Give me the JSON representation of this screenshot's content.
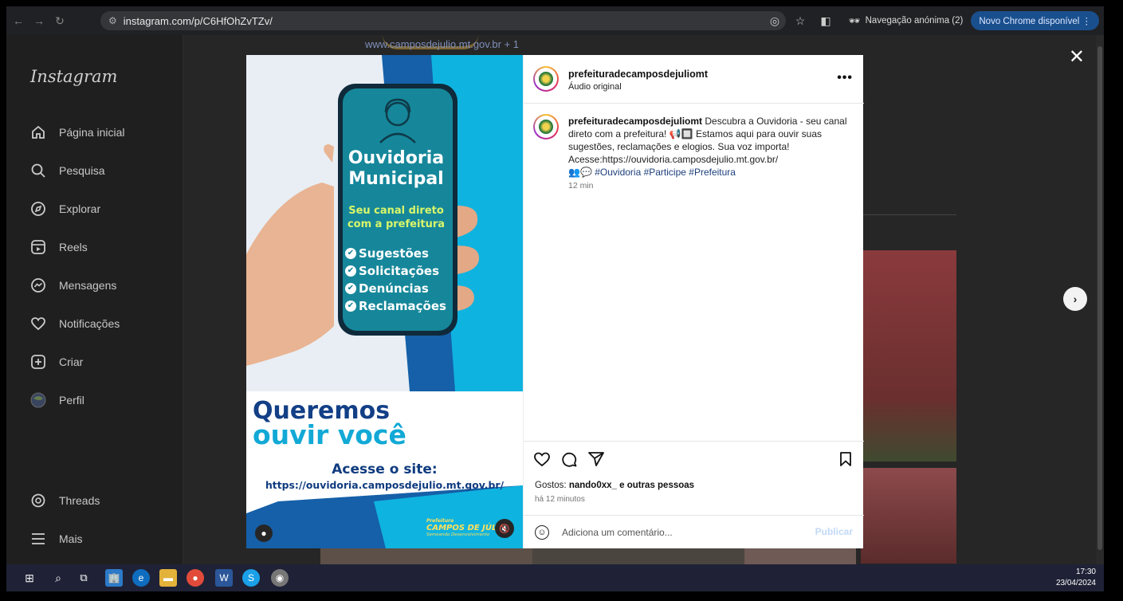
{
  "browser": {
    "url": "instagram.com/p/C6HfOhZvTZv/",
    "incognito_label": "Navegação anónima (2)",
    "update_label": "Novo Chrome disponível"
  },
  "sidebar": {
    "logo": "Instagram",
    "items": [
      {
        "label": "Página inicial",
        "icon": "home-icon"
      },
      {
        "label": "Pesquisa",
        "icon": "search-icon"
      },
      {
        "label": "Explorar",
        "icon": "compass-icon"
      },
      {
        "label": "Reels",
        "icon": "reels-icon"
      },
      {
        "label": "Mensagens",
        "icon": "messenger-icon"
      },
      {
        "label": "Notificações",
        "icon": "heart-icon"
      },
      {
        "label": "Criar",
        "icon": "plus-square-icon"
      },
      {
        "label": "Perfil",
        "icon": "profile-avatar-icon"
      }
    ],
    "bottom_items": [
      {
        "label": "Threads",
        "icon": "threads-icon"
      },
      {
        "label": "Mais",
        "icon": "menu-icon"
      }
    ]
  },
  "background": {
    "link_text": "www.camposdejulio.mt.gov.br + 1"
  },
  "post": {
    "image": {
      "title_line1": "Ouvidoria",
      "title_line2": "Municipal",
      "subtitle_line1": "Seu canal direto",
      "subtitle_line2": "com a prefeitura",
      "list": [
        "Sugestões",
        "Solicitações",
        "Denúncias",
        "Reclamações"
      ],
      "headline_line1": "Queremos",
      "headline_line2": "ouvir você",
      "cta": "Acesse o site:",
      "site": "https://ouvidoria.camposdejulio.mt.gov.br/",
      "logo_small": "Prefeitura",
      "logo_name": "CAMPOS DE JÚLIO",
      "logo_tagline": "Semeando Desenvolvimento"
    },
    "username": "prefeituradecamposdejuliomt",
    "audio": "Áudio original",
    "caption_user": "prefeituradecamposdejuliomt",
    "caption_text": "Descubra a Ouvidoria - seu canal direto com a prefeitura! 📢🔲 Estamos aqui para ouvir suas sugestões, reclamações e elogios. Sua voz importa! Acesse:https://ouvidoria.camposdejulio.mt.gov.br/",
    "caption_tags": "👥💬 #Ouvidoria #Participe #Prefeitura",
    "time": "12 min",
    "likes_prefix": "Gostos: ",
    "likes_user": "nando0xx_",
    "likes_suffix": " e outras pessoas",
    "ago": "há 12 minutos",
    "comment_placeholder": "Adiciona um comentário...",
    "publish_label": "Publicar"
  },
  "taskbar": {
    "time": "17:30",
    "date": "23/04/2024"
  },
  "colors": {
    "image_blue": "#1560a8",
    "image_cyan": "#0fb3e0",
    "phone_teal": "#16879a",
    "lime": "#d8f66a",
    "publish_disabled": "#c1d9f7"
  }
}
